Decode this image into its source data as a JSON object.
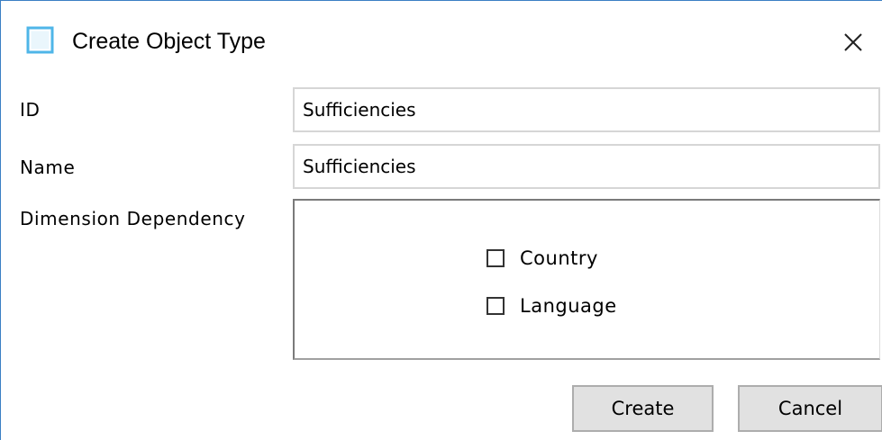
{
  "window": {
    "title": "Create Object Type",
    "icon": "window-app-icon",
    "close_icon": "close-icon"
  },
  "form": {
    "id_label": "ID",
    "id_value": "Sufficiencies",
    "name_label": "Name",
    "name_value": "Sufficiencies",
    "dimension_label": "Dimension Dependency",
    "dimensions": [
      {
        "label": "Country",
        "checked": false
      },
      {
        "label": "Language",
        "checked": false
      }
    ]
  },
  "buttons": {
    "create_label": "Create",
    "cancel_label": "Cancel"
  },
  "colors": {
    "window_border": "#3b7fc4",
    "icon_accent": "#4fb6e8",
    "button_bg": "#e1e1e1"
  }
}
